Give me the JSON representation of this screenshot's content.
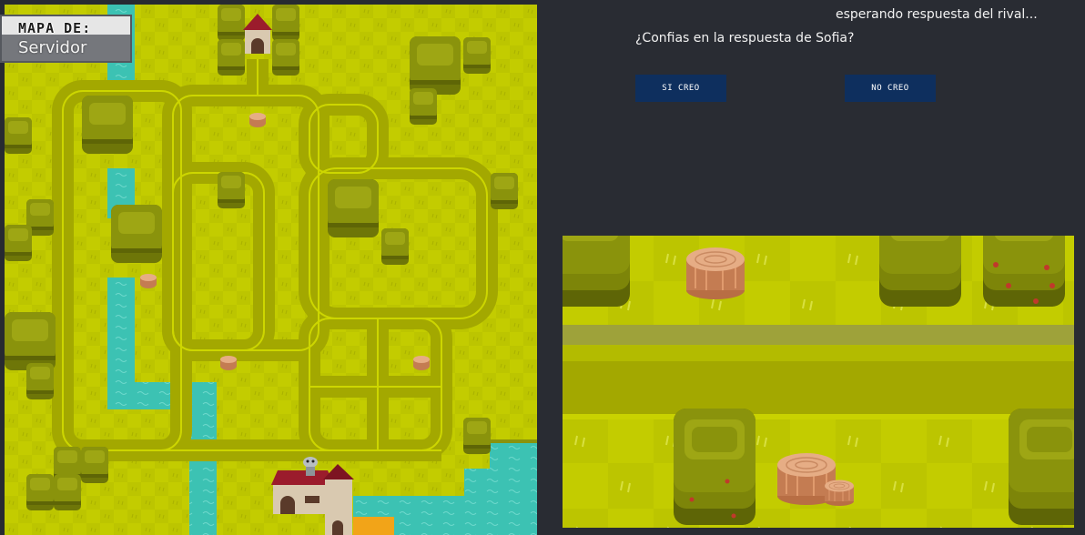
{
  "map": {
    "title": "MAPA DE:",
    "server": "Servidor"
  },
  "dialog": {
    "status": "esperando respuesta del rival...",
    "question": "¿Confias en la respuesta de Sofia?",
    "yes_label": "SI CREO",
    "no_label": "NO CREO"
  },
  "colors": {
    "grass": "#c3cc00",
    "path": "#a3a800",
    "water": "#3cc2b3",
    "bush": "#889010",
    "roof": "#9b1c2c",
    "button": "#0e2f5e",
    "background": "#292c33"
  }
}
